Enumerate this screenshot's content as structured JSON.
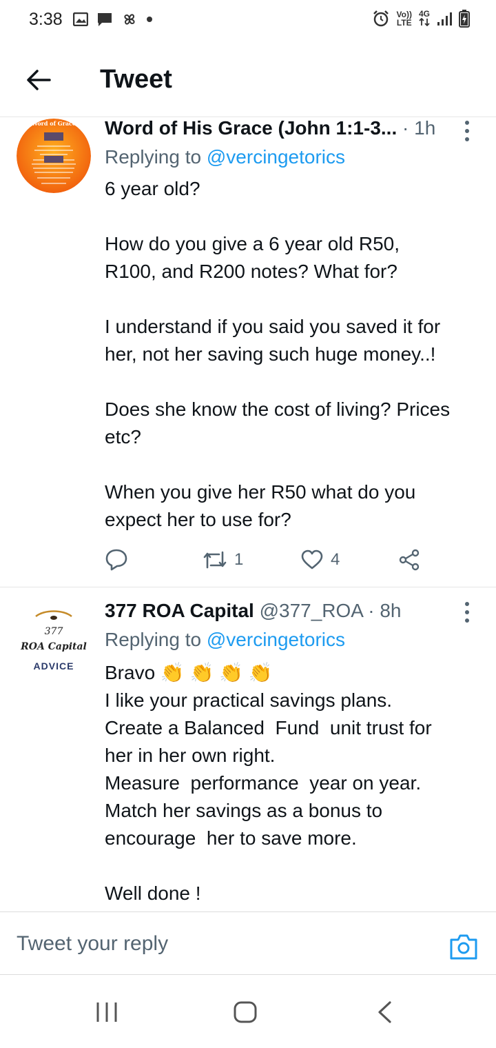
{
  "status_bar": {
    "time": "3:38",
    "volte_line1": "Vo))",
    "volte_line2": "LTE",
    "network_label": "4G"
  },
  "header": {
    "title": "Tweet",
    "back_icon": "arrow-left-icon"
  },
  "tweets": [
    {
      "name": "Word of His Grace (John 1:1-3...",
      "handle": "",
      "time": "· 1h",
      "replying_prefix": "Replying to",
      "replying_handle": "@vercingetorics",
      "body": "6 year old?\n\nHow do you give a 6 year old R50,\nR100, and R200 notes? What for?\n\nI understand if you said you saved it for\nher, not her saving such huge money..!\n\nDoes she know the cost of living? Prices\netc?\n\nWhen you give her R50 what do you\nexpect her to use for?",
      "avatar_label": "Word of Grace",
      "reply_count": "",
      "retweet_count": "1",
      "like_count": "4",
      "accent_color": "#ff6a13"
    },
    {
      "name": "377 ROA Capital",
      "handle": "@377_ROA",
      "time": "· 8h",
      "replying_prefix": "Replying to",
      "replying_handle": "@vercingetorics",
      "body": "Bravo 👏 👏 👏 👏\nI like your practical savings plans.\nCreate a Balanced  Fund  unit trust for\nher in her own right.\nMeasure  performance  year on year.\nMatch her savings as a bonus to\nencourage  her to save more.\n\nWell done !",
      "avatar_line1": "377",
      "avatar_line2": "ROA Capital",
      "avatar_line3": "ADVICE"
    }
  ],
  "reply_bar": {
    "placeholder": "Tweet your reply",
    "camera_icon": "camera-icon"
  },
  "colors": {
    "link": "#1d9bf0",
    "muted": "#536471",
    "text": "#0f1419"
  }
}
